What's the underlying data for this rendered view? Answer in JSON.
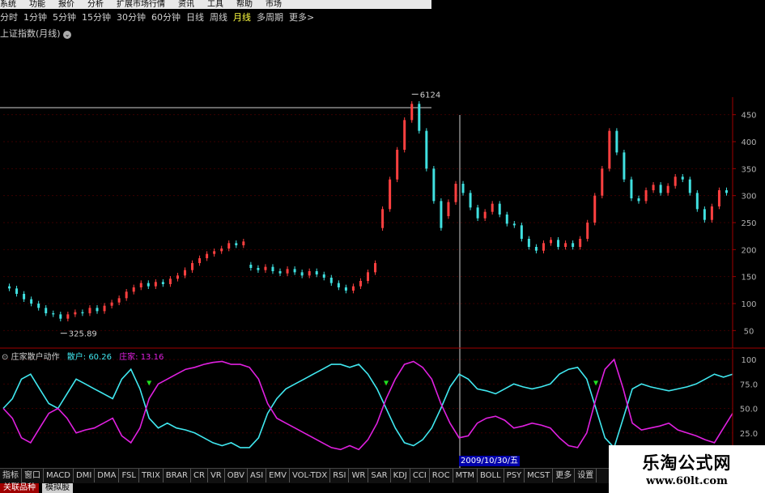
{
  "menubar": [
    "系统",
    "功能",
    "报价",
    "分析",
    "扩展市场行情",
    "资讯",
    "工具",
    "帮助",
    "市场"
  ],
  "periods": [
    {
      "label": "分时",
      "active": false
    },
    {
      "label": "1分钟",
      "active": false
    },
    {
      "label": "5分钟",
      "active": false
    },
    {
      "label": "15分钟",
      "active": false
    },
    {
      "label": "30分钟",
      "active": false
    },
    {
      "label": "60分钟",
      "active": false
    },
    {
      "label": "日线",
      "active": false
    },
    {
      "label": "周线",
      "active": false
    },
    {
      "label": "月线",
      "active": true
    },
    {
      "label": "多周期",
      "active": false
    },
    {
      "label": "更多>",
      "active": false
    }
  ],
  "main_title": "上证指数(月线)",
  "indicator": {
    "name": "庄家散户动作",
    "retail_label": "散户: 60.26",
    "dealer_label": "庄家: 13.16"
  },
  "tabs": [
    "指标",
    "窗口",
    "MACD",
    "DMI",
    "DMA",
    "FSL",
    "TRIX",
    "BRAR",
    "CR",
    "VR",
    "OBV",
    "ASI",
    "EMV",
    "VOL-TDX",
    "RSI",
    "WR",
    "SAR",
    "KDJ",
    "CCI",
    "ROC",
    "MTM",
    "BOLL",
    "PSY",
    "MCST",
    "更多",
    "设置"
  ],
  "bottom_tabs": [
    "关联品种",
    "模拟股"
  ],
  "date_label": "2009/10/30/五",
  "watermark": {
    "title": "乐淘公式网",
    "url": "www.60lt.com"
  },
  "colors": {
    "up": "#ff4040",
    "down": "#40e0e0",
    "retail": "#40e8f0",
    "dealer": "#e020e0",
    "signal": "#20e020",
    "axis": "#a00000"
  },
  "chart_data": [
    {
      "type": "candlestick",
      "title": "上证指数(月线)",
      "y_ticks": [
        450,
        400,
        350,
        300,
        250,
        200,
        150,
        100,
        50
      ],
      "ylim": [
        25,
        475
      ],
      "annotations": [
        {
          "label": "6124",
          "value": 6124
        },
        {
          "label": "325.89",
          "value": 325.89
        }
      ],
      "candles": [
        {
          "o": 132,
          "c": 128
        },
        {
          "o": 128,
          "c": 118
        },
        {
          "o": 118,
          "c": 108
        },
        {
          "o": 108,
          "c": 100
        },
        {
          "o": 100,
          "c": 92
        },
        {
          "o": 92,
          "c": 82
        },
        {
          "o": 82,
          "c": 80
        },
        {
          "o": 80,
          "c": 72
        },
        {
          "o": 72,
          "c": 80
        },
        {
          "o": 80,
          "c": 84
        },
        {
          "o": 84,
          "c": 82
        },
        {
          "o": 82,
          "c": 92
        },
        {
          "o": 92,
          "c": 86
        },
        {
          "o": 86,
          "c": 96
        },
        {
          "o": 96,
          "c": 102
        },
        {
          "o": 102,
          "c": 110
        },
        {
          "o": 110,
          "c": 122
        },
        {
          "o": 122,
          "c": 130
        },
        {
          "o": 130,
          "c": 138
        },
        {
          "o": 138,
          "c": 132
        },
        {
          "o": 132,
          "c": 140
        },
        {
          "o": 140,
          "c": 136
        },
        {
          "o": 136,
          "c": 146
        },
        {
          "o": 146,
          "c": 152
        },
        {
          "o": 152,
          "c": 162
        },
        {
          "o": 162,
          "c": 175
        },
        {
          "o": 175,
          "c": 184
        },
        {
          "o": 184,
          "c": 192
        },
        {
          "o": 192,
          "c": 197
        },
        {
          "o": 197,
          "c": 202
        },
        {
          "o": 202,
          "c": 212
        },
        {
          "o": 212,
          "c": 208
        },
        {
          "o": 208,
          "c": 215
        },
        {
          "o": 172,
          "c": 166
        },
        {
          "o": 166,
          "c": 162
        },
        {
          "o": 162,
          "c": 168
        },
        {
          "o": 168,
          "c": 160
        },
        {
          "o": 160,
          "c": 156
        },
        {
          "o": 156,
          "c": 164
        },
        {
          "o": 164,
          "c": 158
        },
        {
          "o": 158,
          "c": 152
        },
        {
          "o": 152,
          "c": 160
        },
        {
          "o": 160,
          "c": 154
        },
        {
          "o": 154,
          "c": 148
        },
        {
          "o": 148,
          "c": 138
        },
        {
          "o": 138,
          "c": 130
        },
        {
          "o": 130,
          "c": 124
        },
        {
          "o": 124,
          "c": 132
        },
        {
          "o": 132,
          "c": 142
        },
        {
          "o": 142,
          "c": 158
        },
        {
          "o": 158,
          "c": 175
        },
        {
          "o": 240,
          "c": 275
        },
        {
          "o": 275,
          "c": 330
        },
        {
          "o": 330,
          "c": 385
        },
        {
          "o": 385,
          "c": 440
        },
        {
          "o": 440,
          "c": 470
        },
        {
          "o": 470,
          "c": 420
        },
        {
          "o": 420,
          "c": 350
        },
        {
          "o": 350,
          "c": 290
        },
        {
          "o": 290,
          "c": 240
        },
        {
          "o": 262,
          "c": 288
        },
        {
          "o": 288,
          "c": 322
        },
        {
          "o": 322,
          "c": 305
        },
        {
          "o": 305,
          "c": 278
        },
        {
          "o": 278,
          "c": 258
        },
        {
          "o": 258,
          "c": 270
        },
        {
          "o": 270,
          "c": 285
        },
        {
          "o": 285,
          "c": 265
        },
        {
          "o": 265,
          "c": 248
        },
        {
          "o": 248,
          "c": 245
        },
        {
          "o": 245,
          "c": 220
        },
        {
          "o": 220,
          "c": 205
        },
        {
          "o": 205,
          "c": 198
        },
        {
          "o": 198,
          "c": 212
        },
        {
          "o": 212,
          "c": 218
        },
        {
          "o": 218,
          "c": 205
        },
        {
          "o": 205,
          "c": 212
        },
        {
          "o": 212,
          "c": 205
        },
        {
          "o": 205,
          "c": 220
        },
        {
          "o": 220,
          "c": 250
        },
        {
          "o": 250,
          "c": 300
        },
        {
          "o": 300,
          "c": 350
        },
        {
          "o": 350,
          "c": 420
        },
        {
          "o": 420,
          "c": 380
        },
        {
          "o": 380,
          "c": 330
        },
        {
          "o": 330,
          "c": 295
        },
        {
          "o": 295,
          "c": 290
        },
        {
          "o": 290,
          "c": 310
        },
        {
          "o": 310,
          "c": 320
        },
        {
          "o": 320,
          "c": 305
        },
        {
          "o": 305,
          "c": 318
        },
        {
          "o": 318,
          "c": 335
        },
        {
          "o": 335,
          "c": 330
        },
        {
          "o": 330,
          "c": 305
        },
        {
          "o": 305,
          "c": 275
        },
        {
          "o": 275,
          "c": 255
        },
        {
          "o": 255,
          "c": 280
        },
        {
          "o": 280,
          "c": 310
        },
        {
          "o": 310,
          "c": 305
        }
      ]
    },
    {
      "type": "line",
      "title": "庄家散户动作",
      "y_ticks": [
        100,
        75,
        50,
        25
      ],
      "ylim": [
        0,
        110
      ],
      "series": [
        {
          "name": "散户",
          "values": [
            50,
            60,
            80,
            85,
            70,
            55,
            50,
            65,
            80,
            75,
            70,
            65,
            60,
            80,
            90,
            70,
            40,
            30,
            35,
            30,
            28,
            25,
            20,
            15,
            12,
            15,
            10,
            10,
            20,
            45,
            60,
            70,
            75,
            80,
            85,
            90,
            95,
            95,
            92,
            95,
            85,
            70,
            50,
            30,
            15,
            12,
            18,
            30,
            50,
            72,
            85,
            80,
            70,
            68,
            65,
            70,
            75,
            72,
            70,
            72,
            75,
            85,
            90,
            92,
            80,
            50,
            20,
            10,
            40,
            70,
            75,
            72,
            70,
            68,
            70,
            72,
            75,
            80,
            85,
            82,
            85
          ]
        },
        {
          "name": "庄家",
          "values": [
            50,
            40,
            20,
            15,
            30,
            45,
            50,
            40,
            25,
            28,
            30,
            35,
            40,
            22,
            15,
            30,
            60,
            75,
            80,
            85,
            90,
            92,
            95,
            97,
            98,
            95,
            95,
            92,
            80,
            55,
            40,
            35,
            30,
            25,
            20,
            15,
            10,
            8,
            12,
            8,
            18,
            35,
            60,
            80,
            95,
            98,
            92,
            80,
            55,
            35,
            20,
            22,
            35,
            40,
            42,
            38,
            30,
            32,
            35,
            33,
            30,
            20,
            12,
            10,
            25,
            60,
            90,
            100,
            70,
            35,
            28,
            30,
            32,
            35,
            28,
            25,
            22,
            18,
            15,
            30,
            45
          ]
        }
      ]
    }
  ]
}
